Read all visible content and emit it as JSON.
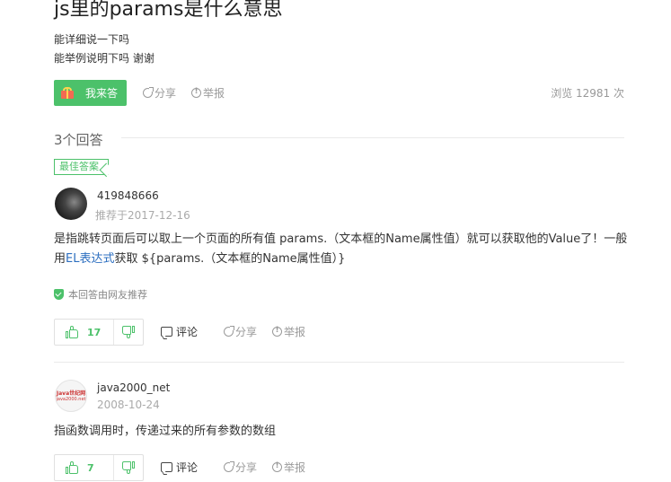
{
  "question": {
    "title": "js里的params是什么意思",
    "desc_line1": "能详细说一下吗",
    "desc_line2": "能举例说明下吗 谢谢",
    "answer_button": "我来答",
    "share": "分享",
    "report": "举报",
    "views": "浏览 12981 次"
  },
  "answers_header": "3个回答",
  "best_badge": "最佳答案",
  "answers": [
    {
      "user": "419848666",
      "date": "推荐于2017-12-16",
      "text_pre": "是指跳转页面后可以取上一个页面的所有值 params.（文本框的Name属性值）就可以获取他的Value了！一般用",
      "text_link": "EL表达式",
      "text_post": "获取 ${params.（文本框的Name属性值）}",
      "recommend": "本回答由网友推荐",
      "likes": "17",
      "comment": "评论",
      "share": "分享",
      "report": "举报"
    },
    {
      "user": "java2000_net",
      "avatar_text1": "Java世纪网",
      "avatar_text2": "java2000.net",
      "date": "2008-10-24",
      "text": "指函数调用时，传递过来的所有参数的数组",
      "likes": "7",
      "comment": "评论",
      "share": "分享",
      "report": "举报"
    }
  ],
  "colors": {
    "green": "#4cc16a",
    "link": "#2d6fc0"
  }
}
